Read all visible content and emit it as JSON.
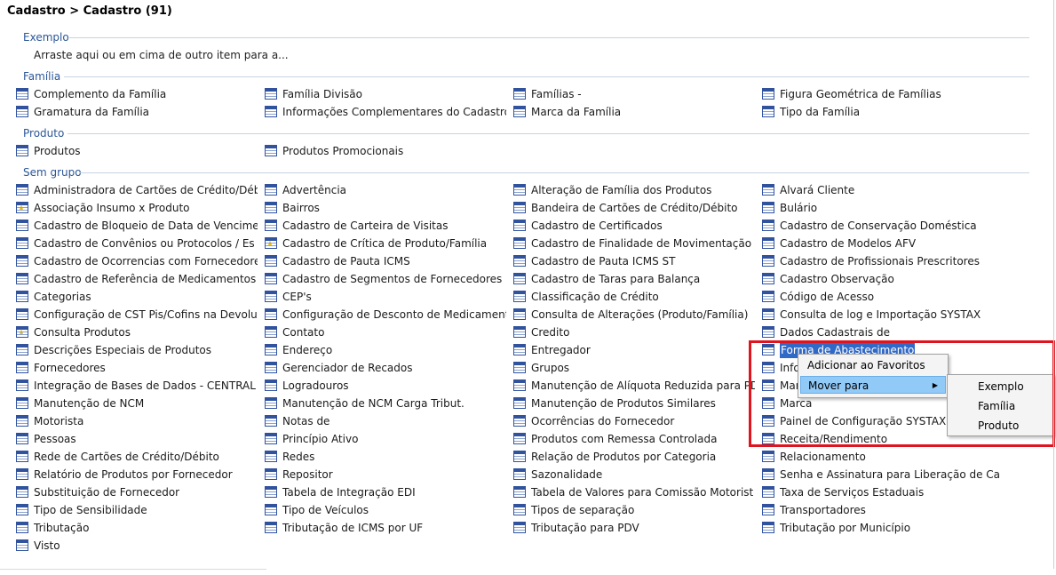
{
  "title": "Cadastro > Cadastro (91)",
  "groups": {
    "exemplo": "Exemplo",
    "familia": "Família",
    "produto": "Produto",
    "sem_grupo": "Sem grupo"
  },
  "hint": "Arraste aqui ou em cima de outro item para a...",
  "familia_items": [
    "Complemento da Família",
    "Família Divisão",
    "Famílias -",
    "Figura Geométrica de Famílias",
    "Gramatura da Família",
    "Informações Complementares do Cadastro F",
    "Marca da Família",
    "Tipo da Família"
  ],
  "produto_items": [
    "Produtos",
    "Produtos Promocionais"
  ],
  "sem_grupo_items": [
    "Administradora de Cartões de Crédito/Déb",
    "Advertência",
    "Alteração de Família dos Produtos",
    "Alvará Cliente",
    "Associação Insumo x Produto",
    "Bairros",
    "Bandeira de Cartões de Crédito/Débito",
    "Bulário",
    "Cadastro de Bloqueio de Data de Vencimen",
    "Cadastro de Carteira de Visitas",
    "Cadastro de Certificados",
    "Cadastro de Conservação Doméstica",
    "Cadastro de Convênios ou Protocolos / Es",
    "Cadastro de Crítica de Produto/Família",
    "Cadastro de Finalidade de Movimentação",
    "Cadastro de Modelos AFV",
    "Cadastro de Ocorrencias com Fornecedores",
    "Cadastro de Pauta ICMS",
    "Cadastro de Pauta ICMS ST",
    "Cadastro de Profissionais Prescritores",
    "Cadastro de Referência de Medicamentos",
    "Cadastro de Segmentos de Fornecedores",
    "Cadastro de Taras para Balança",
    "Cadastro Observação",
    "Categorias",
    "CEP's",
    "Classificação de Crédito",
    "Código de Acesso",
    "Configuração de CST Pis/Cofins na Devolu",
    "Configuração de Desconto de Medicamentos",
    "Consulta de Alterações (Produto/Família)",
    "Consulta de log e Importação SYSTAX",
    "Consulta Produtos",
    "Contato",
    "Credito",
    "Dados Cadastrais de",
    "Descrições Especiais de Produtos",
    "Endereço",
    "Entregador",
    "Forma de Abastecimento",
    "Fornecedores",
    "Gerenciador de Recados",
    "Grupos",
    "Info",
    "Integração de Bases de Dados - CENTRAL",
    "Logradouros",
    "Manutenção de Alíquota Reduzida para PDV",
    "Mar",
    "Manutenção de NCM",
    "Manutenção de NCM Carga Tribut.",
    "Manutenção de Produtos Similares",
    "Marca",
    "Motorista",
    "Notas de",
    "Ocorrências do Fornecedor",
    "Painel de Configuração SYSTAX",
    "Pessoas",
    "Princípio Ativo",
    "Produtos com Remessa Controlada",
    "Receita/Rendimento",
    "Rede de Cartões de Crédito/Débito",
    "Redes",
    "Relação de Produtos por Categoria",
    "Relacionamento",
    "Relatório de Produtos por Fornecedor",
    "Repositor",
    "Sazonalidade",
    "Senha e  Assinatura para Liberação de Ca",
    "Substituição de Fornecedor",
    "Tabela de Integração EDI",
    "Tabela de Valores para Comissão Motorist",
    "Taxa de Serviços Estaduais",
    "Tipo de Sensibilidade",
    "Tipo de Veículos",
    "Tipos de separação",
    "Transportadores",
    "Tributação",
    "Tributação de ICMS por UF",
    "Tributação para PDV",
    "Tributação por Município",
    "Visto"
  ],
  "favorite_items": [
    "Associação Insumo x Produto",
    "Cadastro de Crítica de Produto/Família",
    "Consulta Produtos"
  ],
  "selected_item": "Forma de Abastecimento",
  "context_menu": {
    "add_favorites": "Adicionar ao Favoritos",
    "move_to": "Mover para",
    "submenu": [
      "Exemplo",
      "Família",
      "Produto"
    ]
  },
  "colors": {
    "group_header": "#2b5797",
    "icon": "#31539e",
    "selection": "#3169c6",
    "menu_highlight": "#91c9f7",
    "annotation_box": "#e0141e"
  }
}
